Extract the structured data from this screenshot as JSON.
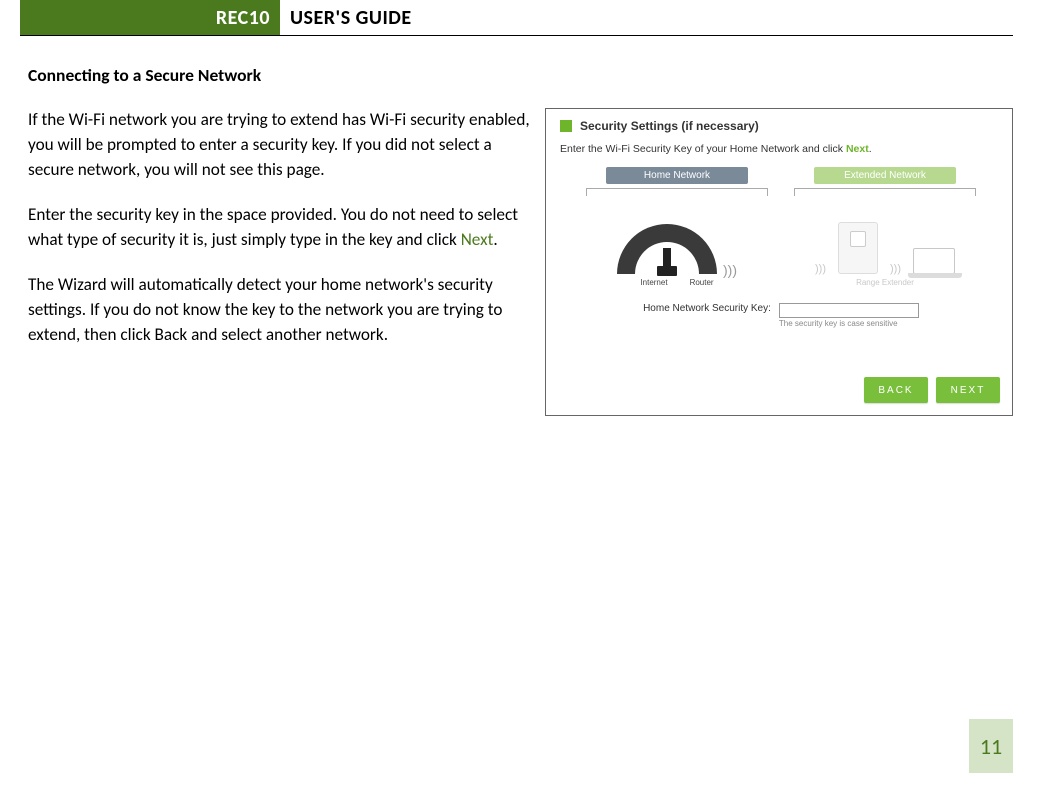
{
  "header": {
    "product": "REC10",
    "title": "USER'S GUIDE"
  },
  "section_title": "Connecting to a Secure Network",
  "paragraphs": {
    "p1": "If the Wi-Fi network you are trying to extend has Wi-Fi security enabled, you will be prompted to enter a security key.  If you did not select a secure network, you will not see this page.",
    "p2a": "Enter the security key in the space provided.  You do not need to select what type of security it is, just simply type in the key and click ",
    "p2_next": "Next",
    "p2b": ".",
    "p3": "The Wizard will automatically detect your home network's security settings. If you do not know the key to the network you are trying to extend, then click Back and select another network."
  },
  "screenshot": {
    "heading": "Security Settings (if necessary)",
    "instruction_a": "Enter the Wi-Fi Security Key of your Home Network and click ",
    "instruction_next": "Next",
    "instruction_b": ".",
    "home_label": "Home Network",
    "ext_label": "Extended Network",
    "dev_internet": "Internet",
    "dev_router": "Router",
    "dev_extender": "Range Extender",
    "key_label": "Home Network Security Key:",
    "key_note": "The security key is case sensitive",
    "btn_back": "BACK",
    "btn_next": "NEXT"
  },
  "page_number": "11"
}
